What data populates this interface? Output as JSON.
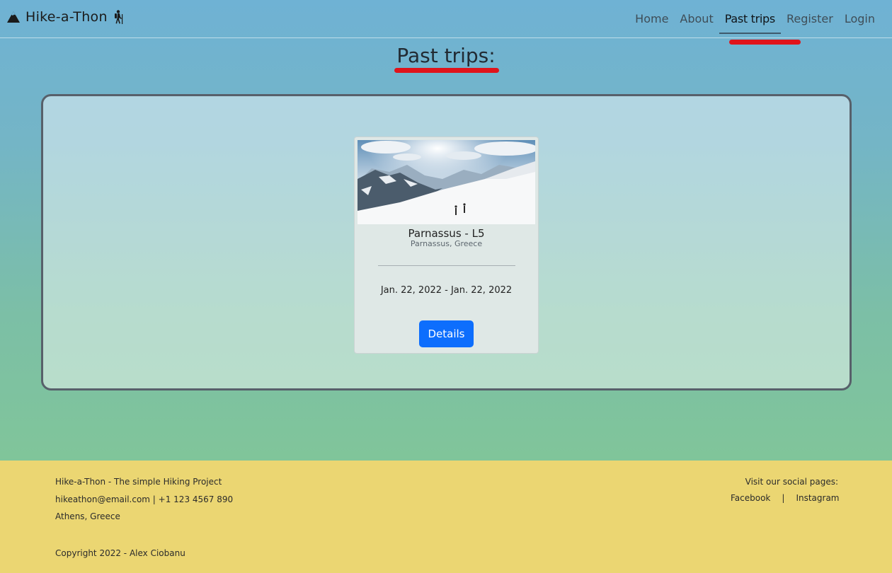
{
  "navbar": {
    "brand": "Hike-a-Thon",
    "links": [
      "Home",
      "About",
      "Past trips",
      "Register",
      "Login"
    ],
    "active": "Past trips"
  },
  "page": {
    "title": "Past trips:"
  },
  "trips": [
    {
      "name": "Parnassus - L5",
      "location": "Parnassus, Greece",
      "dates": "Jan. 22, 2022 - Jan. 22, 2022",
      "button": "Details"
    }
  ],
  "footer": {
    "line1": "Hike-a-Thon - The simple Hiking Project",
    "line2": "hikeathon@email.com | +1 123 4567 890",
    "line3": "Athens, Greece",
    "copyright": "Copyright 2022 - Alex Ciobanu",
    "social_heading": "Visit our social pages:",
    "facebook": "Facebook",
    "separator": "|",
    "instagram": "Instagram"
  },
  "icons": {
    "brand_left": "mountain-icon",
    "brand_right": "hiker-icon"
  },
  "colors": {
    "primary_button": "#0d6efd",
    "footer_bg": "#ebd672",
    "annotation_red": "#e0141b"
  }
}
